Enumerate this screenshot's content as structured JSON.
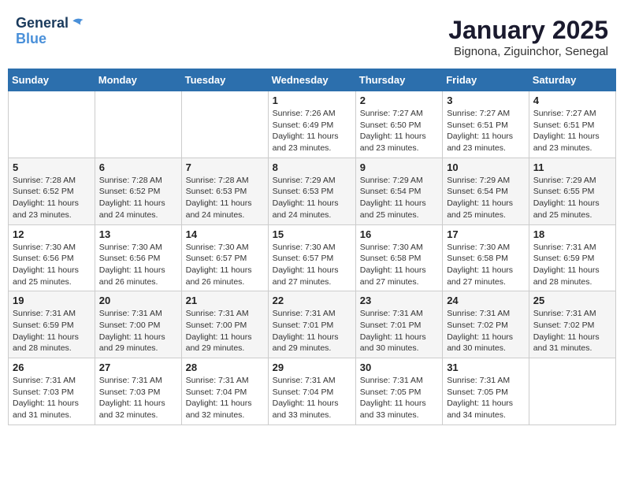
{
  "logo": {
    "line1": "General",
    "line2": "Blue"
  },
  "title": "January 2025",
  "subtitle": "Bignona, Ziguinchor, Senegal",
  "days_of_week": [
    "Sunday",
    "Monday",
    "Tuesday",
    "Wednesday",
    "Thursday",
    "Friday",
    "Saturday"
  ],
  "weeks": [
    [
      {
        "day": "",
        "content": ""
      },
      {
        "day": "",
        "content": ""
      },
      {
        "day": "",
        "content": ""
      },
      {
        "day": "1",
        "content": "Sunrise: 7:26 AM\nSunset: 6:49 PM\nDaylight: 11 hours and 23 minutes."
      },
      {
        "day": "2",
        "content": "Sunrise: 7:27 AM\nSunset: 6:50 PM\nDaylight: 11 hours and 23 minutes."
      },
      {
        "day": "3",
        "content": "Sunrise: 7:27 AM\nSunset: 6:51 PM\nDaylight: 11 hours and 23 minutes."
      },
      {
        "day": "4",
        "content": "Sunrise: 7:27 AM\nSunset: 6:51 PM\nDaylight: 11 hours and 23 minutes."
      }
    ],
    [
      {
        "day": "5",
        "content": "Sunrise: 7:28 AM\nSunset: 6:52 PM\nDaylight: 11 hours and 23 minutes."
      },
      {
        "day": "6",
        "content": "Sunrise: 7:28 AM\nSunset: 6:52 PM\nDaylight: 11 hours and 24 minutes."
      },
      {
        "day": "7",
        "content": "Sunrise: 7:28 AM\nSunset: 6:53 PM\nDaylight: 11 hours and 24 minutes."
      },
      {
        "day": "8",
        "content": "Sunrise: 7:29 AM\nSunset: 6:53 PM\nDaylight: 11 hours and 24 minutes."
      },
      {
        "day": "9",
        "content": "Sunrise: 7:29 AM\nSunset: 6:54 PM\nDaylight: 11 hours and 25 minutes."
      },
      {
        "day": "10",
        "content": "Sunrise: 7:29 AM\nSunset: 6:54 PM\nDaylight: 11 hours and 25 minutes."
      },
      {
        "day": "11",
        "content": "Sunrise: 7:29 AM\nSunset: 6:55 PM\nDaylight: 11 hours and 25 minutes."
      }
    ],
    [
      {
        "day": "12",
        "content": "Sunrise: 7:30 AM\nSunset: 6:56 PM\nDaylight: 11 hours and 25 minutes."
      },
      {
        "day": "13",
        "content": "Sunrise: 7:30 AM\nSunset: 6:56 PM\nDaylight: 11 hours and 26 minutes."
      },
      {
        "day": "14",
        "content": "Sunrise: 7:30 AM\nSunset: 6:57 PM\nDaylight: 11 hours and 26 minutes."
      },
      {
        "day": "15",
        "content": "Sunrise: 7:30 AM\nSunset: 6:57 PM\nDaylight: 11 hours and 27 minutes."
      },
      {
        "day": "16",
        "content": "Sunrise: 7:30 AM\nSunset: 6:58 PM\nDaylight: 11 hours and 27 minutes."
      },
      {
        "day": "17",
        "content": "Sunrise: 7:30 AM\nSunset: 6:58 PM\nDaylight: 11 hours and 27 minutes."
      },
      {
        "day": "18",
        "content": "Sunrise: 7:31 AM\nSunset: 6:59 PM\nDaylight: 11 hours and 28 minutes."
      }
    ],
    [
      {
        "day": "19",
        "content": "Sunrise: 7:31 AM\nSunset: 6:59 PM\nDaylight: 11 hours and 28 minutes."
      },
      {
        "day": "20",
        "content": "Sunrise: 7:31 AM\nSunset: 7:00 PM\nDaylight: 11 hours and 29 minutes."
      },
      {
        "day": "21",
        "content": "Sunrise: 7:31 AM\nSunset: 7:00 PM\nDaylight: 11 hours and 29 minutes."
      },
      {
        "day": "22",
        "content": "Sunrise: 7:31 AM\nSunset: 7:01 PM\nDaylight: 11 hours and 29 minutes."
      },
      {
        "day": "23",
        "content": "Sunrise: 7:31 AM\nSunset: 7:01 PM\nDaylight: 11 hours and 30 minutes."
      },
      {
        "day": "24",
        "content": "Sunrise: 7:31 AM\nSunset: 7:02 PM\nDaylight: 11 hours and 30 minutes."
      },
      {
        "day": "25",
        "content": "Sunrise: 7:31 AM\nSunset: 7:02 PM\nDaylight: 11 hours and 31 minutes."
      }
    ],
    [
      {
        "day": "26",
        "content": "Sunrise: 7:31 AM\nSunset: 7:03 PM\nDaylight: 11 hours and 31 minutes."
      },
      {
        "day": "27",
        "content": "Sunrise: 7:31 AM\nSunset: 7:03 PM\nDaylight: 11 hours and 32 minutes."
      },
      {
        "day": "28",
        "content": "Sunrise: 7:31 AM\nSunset: 7:04 PM\nDaylight: 11 hours and 32 minutes."
      },
      {
        "day": "29",
        "content": "Sunrise: 7:31 AM\nSunset: 7:04 PM\nDaylight: 11 hours and 33 minutes."
      },
      {
        "day": "30",
        "content": "Sunrise: 7:31 AM\nSunset: 7:05 PM\nDaylight: 11 hours and 33 minutes."
      },
      {
        "day": "31",
        "content": "Sunrise: 7:31 AM\nSunset: 7:05 PM\nDaylight: 11 hours and 34 minutes."
      },
      {
        "day": "",
        "content": ""
      }
    ]
  ]
}
